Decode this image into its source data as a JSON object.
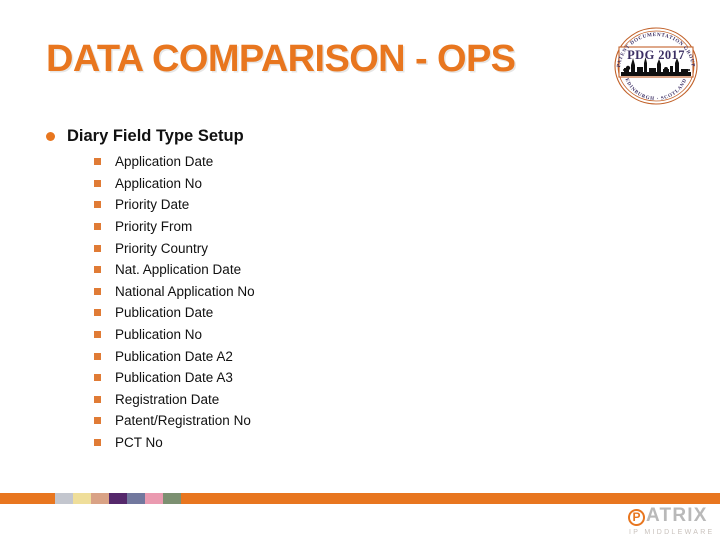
{
  "slide": {
    "title": "DATA COMPARISON - OPS",
    "title_color": "#E8761F",
    "background_color": "#ffffff"
  },
  "conference_logo": {
    "name": "pdg-2017-stamp",
    "center_text": "PDG 2017",
    "top_arc_text": "PATENT DOCUMENTATION GROUP",
    "bottom_arc_text": "EDINBURGH · SCOTLAND",
    "border_color": "#C2622A",
    "text_color": "#3B2E63",
    "skyline_color": "#111111"
  },
  "content": {
    "heading": {
      "label": "Diary Field Type Setup",
      "bullet_color": "#E8761F"
    },
    "items": [
      {
        "label": "Application Date"
      },
      {
        "label": "Application No"
      },
      {
        "label": "Priority Date"
      },
      {
        "label": "Priority From"
      },
      {
        "label": "Priority Country"
      },
      {
        "label": "Nat. Application Date"
      },
      {
        "label": "National Application No"
      },
      {
        "label": "Publication Date"
      },
      {
        "label": "Publication No"
      },
      {
        "label": "Publication Date A2"
      },
      {
        "label": "Publication Date A3"
      },
      {
        "label": "Registration Date"
      },
      {
        "label": "Patent/Registration No"
      },
      {
        "label": "PCT No"
      }
    ],
    "item_bullet_color": "#E07B35"
  },
  "footer": {
    "bar_color": "#E8761F",
    "swatches": [
      {
        "name": "swatch-light-gray-blue",
        "color": "#C3C6CE"
      },
      {
        "name": "swatch-pale-yellow",
        "color": "#EFDE9A"
      },
      {
        "name": "swatch-tan",
        "color": "#D9A285"
      },
      {
        "name": "swatch-dark-purple",
        "color": "#55286B"
      },
      {
        "name": "swatch-blue-gray",
        "color": "#72789E"
      },
      {
        "name": "swatch-pink",
        "color": "#EA9AB0"
      },
      {
        "name": "swatch-sage-green",
        "color": "#7C9071"
      }
    ]
  },
  "brand": {
    "name": "PATRIX",
    "mark_letter": "P",
    "word": "ATRIX",
    "tagline": "IP MIDDLEWARE",
    "accent_color": "#E8761F",
    "word_color": "#B9B9B9"
  }
}
